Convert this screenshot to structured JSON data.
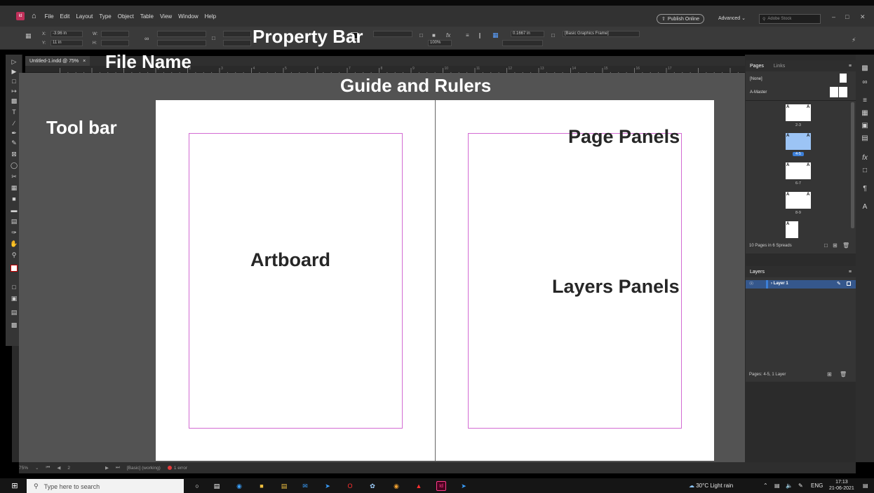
{
  "menubar": {
    "app_badge": "Id",
    "items": [
      "File",
      "Edit",
      "Layout",
      "Type",
      "Object",
      "Table",
      "View",
      "Window",
      "Help"
    ],
    "publish_online": "Publish Online",
    "advanced": "Advanced",
    "stock_placeholder": "Adobe Stock"
  },
  "propbar": {
    "x_label": "X:",
    "x_value": "-3.96 in",
    "y_label": "Y:",
    "y_value": "11 in",
    "w_label": "W:",
    "h_label": "H:",
    "zoom": "100%",
    "stroke_weight": "0.1667 in",
    "object_style": "[Basic Graphics Frame]"
  },
  "document": {
    "tab_title": "Untitled-1.indd @ 75%",
    "tab_close": "×"
  },
  "annotations": {
    "property_bar": "Property Bar",
    "file_name": "File Name",
    "guide_rulers": "Guide and Rulers",
    "tool_bar": "Tool bar",
    "page_panels": "Page Panels",
    "artboard": "Artboard",
    "layers_panels": "Layers Panels"
  },
  "pages_panel": {
    "tab_pages": "Pages",
    "tab_links": "Links",
    "none_master": "[None]",
    "a_master": "A-Master",
    "page_letter": "A",
    "spreads": [
      {
        "label": "2-3",
        "selected": false
      },
      {
        "label": "4-5",
        "selected": true
      },
      {
        "label": "6-7",
        "selected": false
      },
      {
        "label": "8-9",
        "selected": false
      }
    ],
    "footer": "10 Pages in 6 Spreads"
  },
  "layers_panel": {
    "title": "Layers",
    "layer_name": "Layer 1",
    "footer": "Pages: 4-5, 1 Layer"
  },
  "ruler_ticks": [
    "1",
    "2",
    "3",
    "4",
    "5",
    "6",
    "7",
    "8",
    "9",
    "10",
    "11",
    "12",
    "13",
    "14",
    "15",
    "16",
    "17"
  ],
  "statusbar": {
    "zoom": "75%",
    "page": "2",
    "profile": "[Basic] (working)",
    "errors": "1 error"
  },
  "taskbar": {
    "search_placeholder": "Type here to search",
    "weather": "30°C  Light rain",
    "lang": "ENG",
    "time": "17:13",
    "date": "21-06-2021"
  },
  "colors": {
    "accent_blue": "#3c7fd8",
    "margin_magenta": "#d36bd3",
    "indesign_brand": "#c0305a",
    "error_red": "#e23b3b"
  }
}
